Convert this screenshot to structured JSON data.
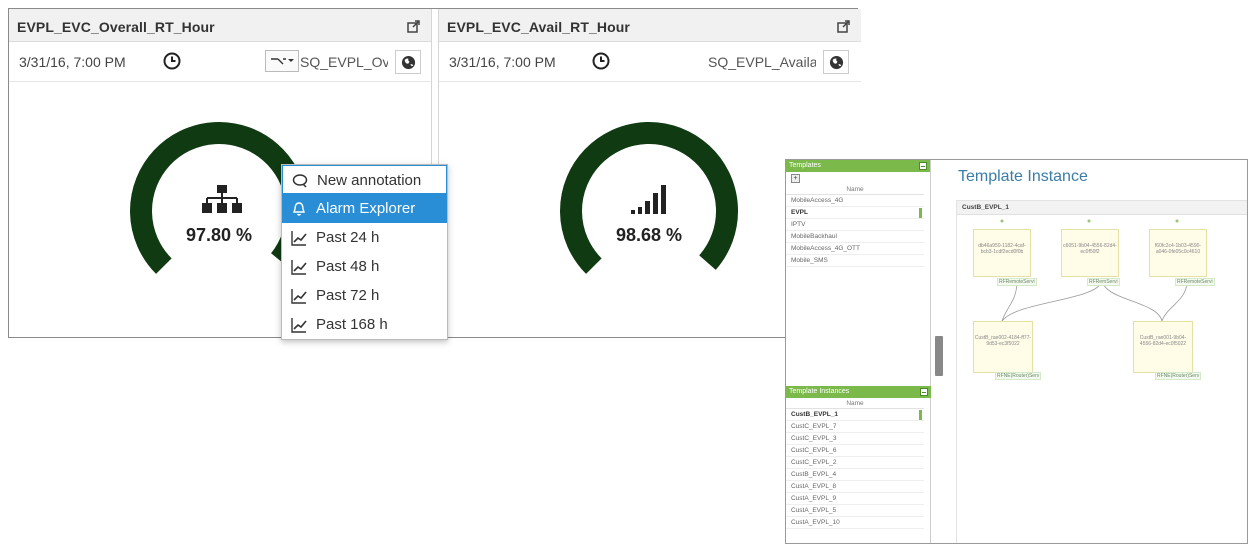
{
  "dashboard": {
    "panels": [
      {
        "title": "EVPL_EVC_Overall_RT_Hour",
        "date": "3/31/16, 7:00 PM",
        "source": "SQ_EVPL_Ov",
        "value": "97.80 %",
        "center_icon": "hierarchy-icon",
        "gauge_fraction": 0.978
      },
      {
        "title": "EVPL_EVC_Avail_RT_Hour",
        "date": "3/31/16, 7:00 PM",
        "source": "SQ_EVPL_Availa",
        "value": "98.68 %",
        "center_icon": "signal-bars-icon",
        "gauge_fraction": 0.9868
      }
    ],
    "gauge_color": "#0f3a12"
  },
  "context_menu": {
    "items": [
      {
        "label": "New annotation",
        "icon": "annotation-icon",
        "state": "focused"
      },
      {
        "label": "Alarm Explorer",
        "icon": "bell-icon",
        "state": "active"
      },
      {
        "label": "Past 24 h",
        "icon": "trend-icon",
        "state": ""
      },
      {
        "label": "Past 48 h",
        "icon": "trend-icon",
        "state": ""
      },
      {
        "label": "Past 72 h",
        "icon": "trend-icon",
        "state": ""
      },
      {
        "label": "Past 168 h",
        "icon": "trend-icon",
        "state": ""
      }
    ],
    "accent": "#2a8ed6"
  },
  "template_window": {
    "templates_header": "Templates",
    "name_column": "Name",
    "templates": [
      "MobileAccess_4G",
      "EVPL",
      "IPTV",
      "MobileBackhaul",
      "MobileAccess_4G_OTT",
      "Mobile_SMS"
    ],
    "instances_header": "Template Instances",
    "instances": [
      "CustB_EVPL_1",
      "CustC_EVPL_7",
      "CustC_EVPL_3",
      "CustC_EVPL_6",
      "CustC_EVPL_2",
      "CustB_EVPL_4",
      "CustA_EVPL_8",
      "CustA_EVPL_9",
      "CustA_EVPL_5",
      "CustA_EVPL_10"
    ],
    "title": "Template Instance",
    "diagram_title": "CustB_EVPL_1",
    "nodes_top": [
      {
        "id": "db46a950-1182-4caf-bcb3-1cdf2ecd0f0b",
        "label": "RFRemoteServi"
      },
      {
        "id": "c6051-9b04-4556-82d4-ec0f50f2",
        "label": "RFRemServi"
      },
      {
        "id": "f60fc2c4-1b03-4590-a046-0fe05c0c4610",
        "label": "RFRemoteServi"
      }
    ],
    "nodes_bottom": [
      {
        "id": "CustB_rae002-4184-ff77-9d53-ec3f5022",
        "label": "RFNE(Router)Serv"
      },
      {
        "id": "CustB_rae001-9b04-4556-82d4-ec0f5022",
        "label": "RFNE(Router)Serv"
      }
    ],
    "accent": "#7bb94a"
  }
}
